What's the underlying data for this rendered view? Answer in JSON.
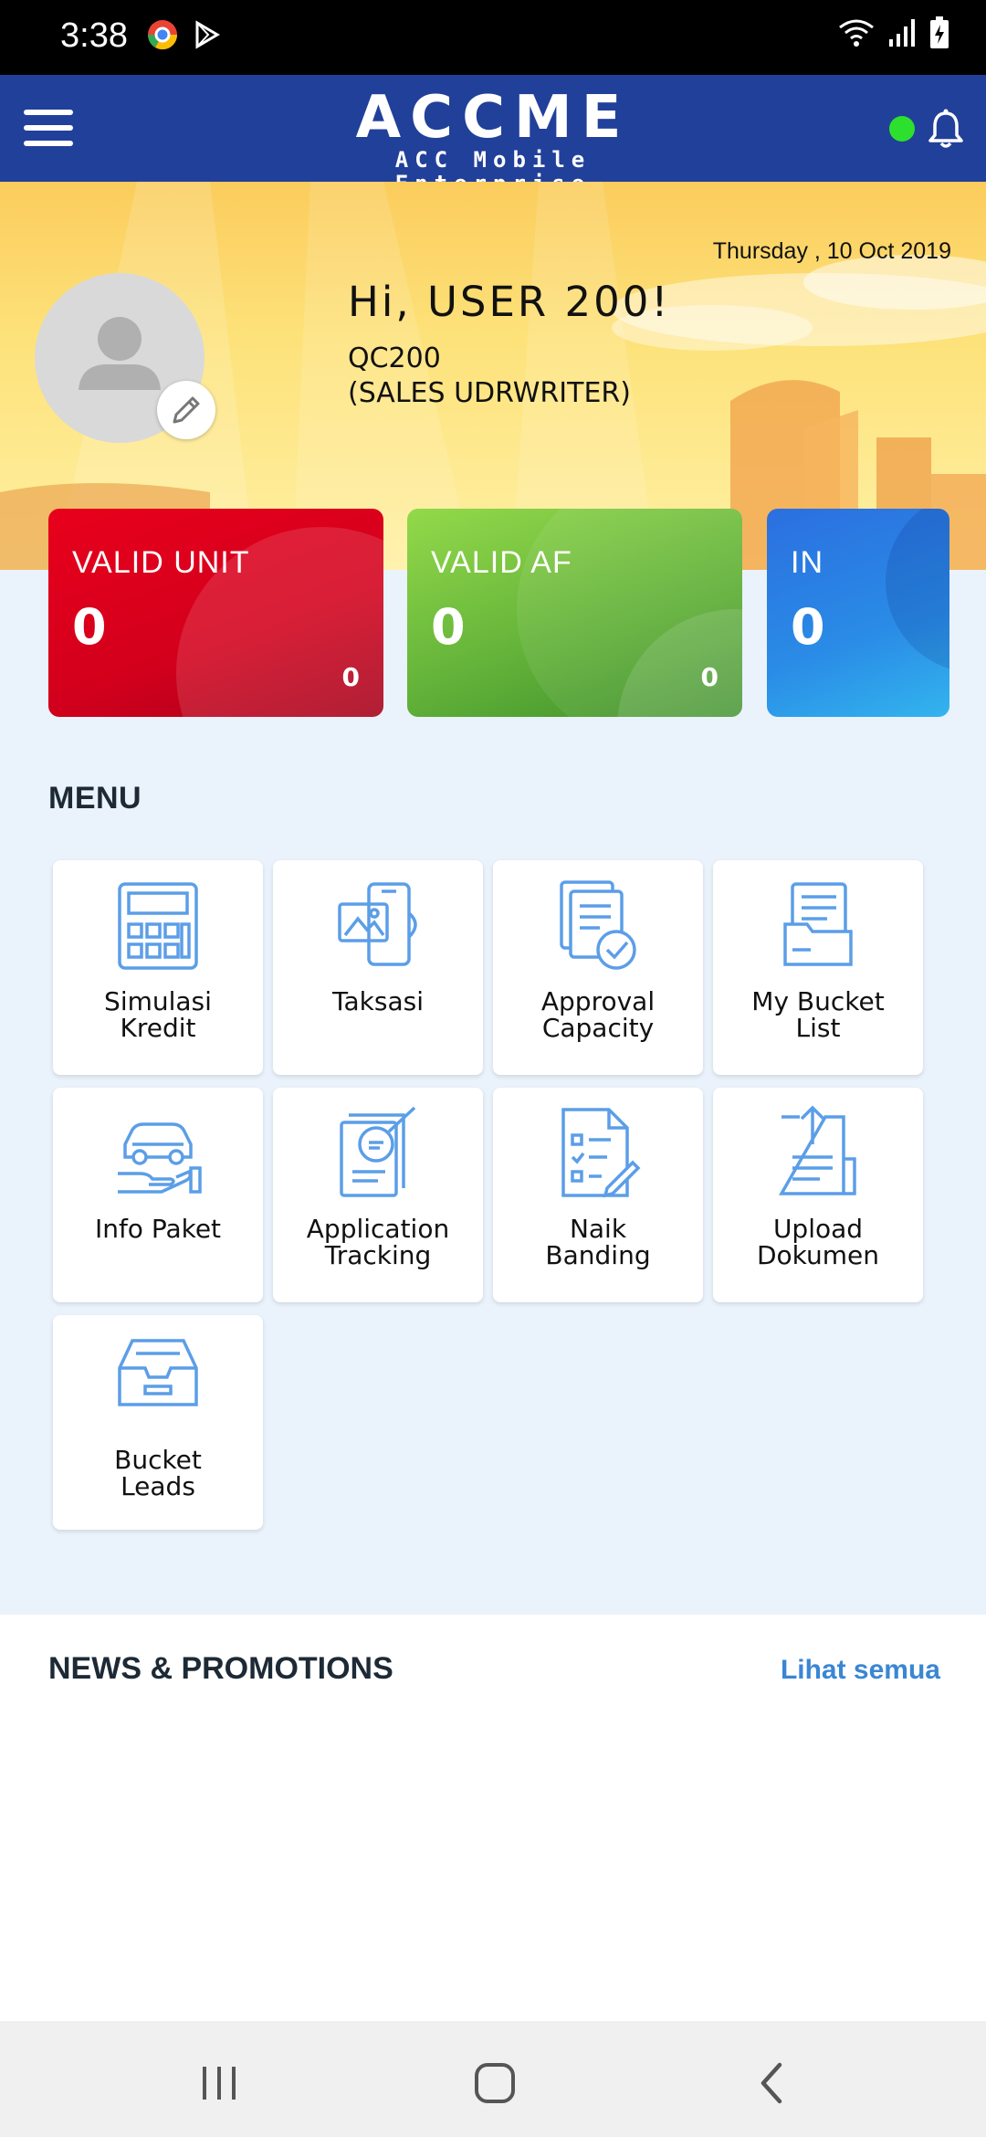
{
  "status_bar": {
    "time": "3:38",
    "icons": [
      "chrome-icon",
      "play-store-icon",
      "wifi-icon",
      "signal-icon",
      "battery-icon"
    ]
  },
  "header": {
    "brand": "ACCME",
    "tagline": "ACC Mobile Enterprise",
    "online_status_color": "#2ee02e",
    "background_color": "#21409a"
  },
  "profile": {
    "date": "Thursday , 10 Oct 2019",
    "greeting": "Hi, USER 200!",
    "user_code": "QC200",
    "role": "(SALES UDRWRITER)"
  },
  "stats": [
    {
      "label": "VALID UNIT",
      "value": "0",
      "sub_value": "0",
      "color": "#d8001c"
    },
    {
      "label": "VALID AF",
      "value": "0",
      "sub_value": "0",
      "color": "#64b33a"
    },
    {
      "label": "IN",
      "value": "0",
      "color": "#2a8ce6"
    }
  ],
  "menu": {
    "title": "MENU",
    "items": [
      {
        "label": "Simulasi Kredit",
        "icon": "calculator-icon"
      },
      {
        "label": "Taksasi",
        "icon": "photo-phone-icon"
      },
      {
        "label": "Approval Capacity",
        "icon": "approval-document-icon"
      },
      {
        "label": "My Bucket List",
        "icon": "folder-document-icon"
      },
      {
        "label": "Info Paket",
        "icon": "car-in-hand-icon"
      },
      {
        "label": "Application Tracking",
        "icon": "tracking-document-icon"
      },
      {
        "label": "Naik Banding",
        "icon": "checklist-document-icon"
      },
      {
        "label": "Upload Dokumen",
        "icon": "upload-document-icon"
      },
      {
        "label": "Bucket Leads",
        "icon": "inbox-tray-icon"
      }
    ]
  },
  "news": {
    "title": "NEWS & PROMOTIONS",
    "link": "Lihat semua"
  },
  "accent_color": "#3a86d4",
  "icon_color": "#5b9ee8"
}
